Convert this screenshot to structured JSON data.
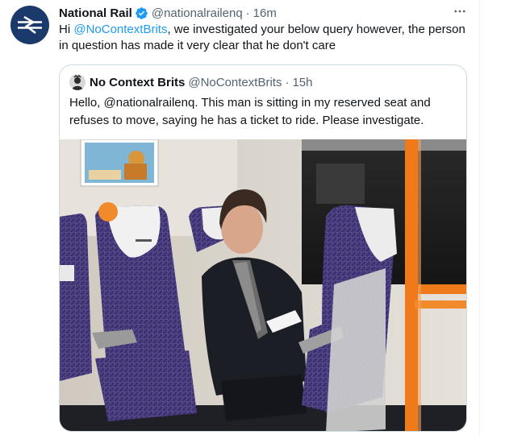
{
  "tweet": {
    "author_name": "National Rail",
    "author_handle": "@nationalrailenq",
    "separator": "·",
    "time": "16m",
    "text_prefix": "Hi ",
    "mention": "@NoContextBrits",
    "text_suffix": ", we investigated your below query however, the person in question has made it very clear that he don't care"
  },
  "quote": {
    "author_name": "No Context Brits",
    "author_handle": "@NoContextBrits",
    "separator": "·",
    "time": "15h",
    "text": "Hello, @nationalrailenq. This man is sitting in my reserved seat and refuses to move, saying he has a ticket to ride. Please investigate."
  },
  "icons": {
    "avatar": "national-rail-logo",
    "verified": "verified-badge-icon",
    "more": "more-options-icon"
  },
  "colors": {
    "link": "#1d9bf0",
    "verified": "#1d9bf0",
    "brand": "#1a3a6b",
    "seat": "#3a2f6e",
    "handrail": "#ee7a1a"
  }
}
